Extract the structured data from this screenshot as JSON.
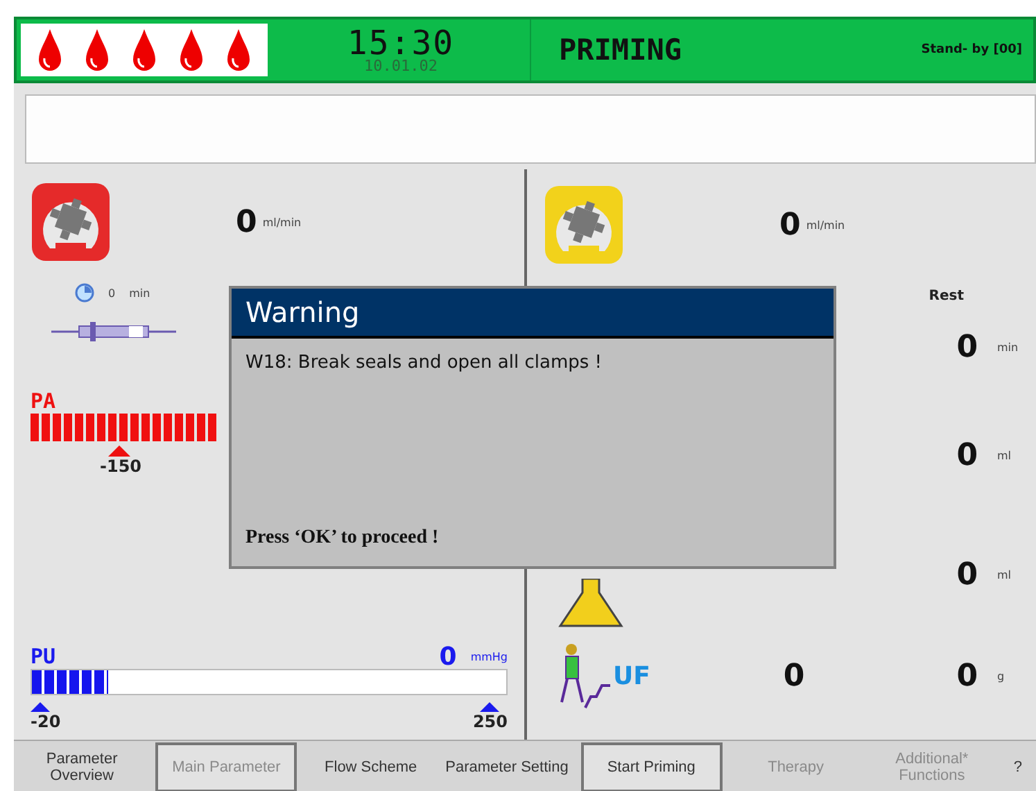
{
  "header": {
    "time": "15:30",
    "date": "10.01.02",
    "mode": "PRIMING",
    "status": "Stand- by [00]"
  },
  "left": {
    "pump": {
      "value": "0",
      "unit": "ml/min",
      "color": "#e52a2a"
    },
    "timer": {
      "value": "0",
      "unit": "min"
    },
    "pa": {
      "label": "PA",
      "marker": "-150"
    },
    "pu": {
      "label": "PU",
      "value": "0",
      "unit": "mmHg",
      "level": 0.16,
      "min": "-20",
      "max": "250"
    }
  },
  "right": {
    "pump": {
      "value": "0",
      "unit": "ml/min",
      "color": "#f2d21b"
    },
    "rest_header": "Rest",
    "rows": [
      {
        "kind": "plain",
        "value": "0",
        "unit": "min"
      },
      {
        "kind": "plain",
        "value": "0",
        "unit": "ml"
      },
      {
        "kind": "flask",
        "value": "0",
        "unit": "ml"
      },
      {
        "kind": "uf",
        "current": "0",
        "value": "0",
        "unit": "g",
        "label": "UF"
      }
    ]
  },
  "dialog": {
    "title": "Warning",
    "message": "W18: Break seals and open all clamps !",
    "footer": "Press ‘OK’ to proceed !"
  },
  "menu": [
    {
      "label": "Parameter Overview",
      "disabled": false,
      "boxed": false
    },
    {
      "label": "Main Parameter",
      "disabled": true,
      "boxed": true
    },
    {
      "label": "Flow Scheme",
      "disabled": false,
      "boxed": false
    },
    {
      "label": "Parameter Setting",
      "disabled": false,
      "boxed": false
    },
    {
      "label": "Start Priming",
      "disabled": false,
      "boxed": true
    },
    {
      "label": "Therapy",
      "disabled": true,
      "boxed": false
    },
    {
      "label": "Additional* Functions",
      "disabled": true,
      "boxed": false
    },
    {
      "label": "?",
      "disabled": false,
      "boxed": false
    }
  ]
}
